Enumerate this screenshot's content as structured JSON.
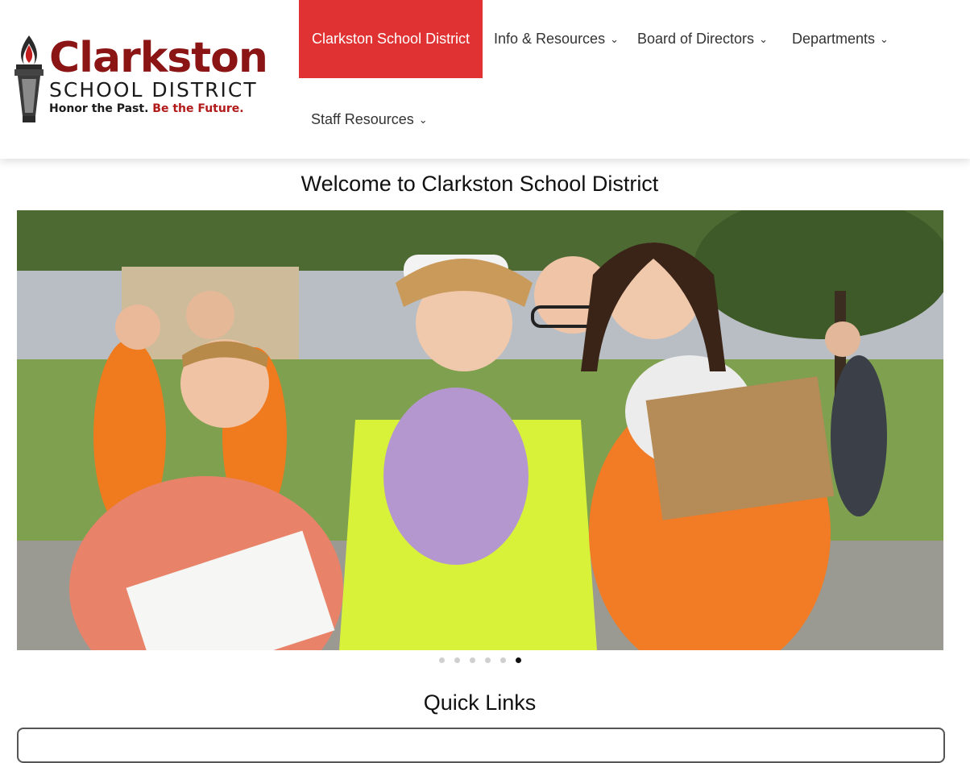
{
  "logo": {
    "name": "Clarkston",
    "subtitle": "SCHOOL DISTRICT",
    "tagline_part1": "Honor the Past.",
    "tagline_part2": "Be the Future.",
    "colors": {
      "brand": "#8b1414",
      "accent": "#b21a1a"
    }
  },
  "nav": {
    "items": [
      {
        "label": "Clarkston School District",
        "active": true
      },
      {
        "label": "Info & Resources",
        "dropdown": true
      },
      {
        "label": "Board of Directors",
        "dropdown": true
      },
      {
        "label": "Departments",
        "dropdown": true
      },
      {
        "label": "Staff Resources",
        "dropdown": true
      }
    ],
    "chevron_icon": "chevron-down-icon",
    "active_color": "#e03232"
  },
  "main": {
    "welcome_title": "Welcome to Clarkston School District",
    "quick_links_title": "Quick Links"
  },
  "carousel": {
    "slide_count": 6,
    "active_index": 5
  }
}
